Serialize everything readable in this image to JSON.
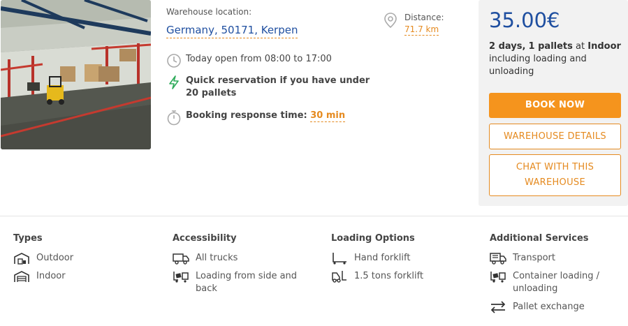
{
  "location": {
    "label": "Warehouse location:",
    "value": "Germany, 50171, Kerpen"
  },
  "distance": {
    "label": "Distance:",
    "value": "71.7 km"
  },
  "features": {
    "hours": "Today open from 08:00 to 17:00",
    "quick": "Quick reservation if you have under 20 pallets",
    "response_label": "Booking response time:",
    "response_value": "30 min"
  },
  "pricing": {
    "price": "35.00€",
    "days": "2 days,",
    "pallets": "1 pallets",
    "at": "at",
    "type": "Indoor",
    "rest": "including loading and unloading"
  },
  "buttons": {
    "book": "BOOK NOW",
    "details": "WAREHOUSE DETAILS",
    "chat": "CHAT WITH THIS WAREHOUSE"
  },
  "sections": {
    "types": {
      "title": "Types",
      "items": [
        "Outdoor",
        "Indoor"
      ]
    },
    "accessibility": {
      "title": "Accessibility",
      "items": [
        "All trucks",
        "Loading from side and back"
      ]
    },
    "loading": {
      "title": "Loading Options",
      "items": [
        "Hand forklift",
        "1.5 tons forklift"
      ]
    },
    "services": {
      "title": "Additional Services",
      "items": [
        "Transport",
        "Container loading / unloading",
        "Pallet exchange"
      ]
    }
  },
  "colors": {
    "accent": "#f5941d",
    "link": "#1f4fa0",
    "panel": "#f2f2f2"
  },
  "icons": [
    "location-pin-icon",
    "clock-icon",
    "lightning-icon",
    "stopwatch-icon",
    "warehouse-outdoor-icon",
    "warehouse-indoor-icon",
    "truck-icon",
    "side-loading-icon",
    "hand-forklift-icon",
    "forklift-icon",
    "transport-truck-icon",
    "container-loading-icon",
    "pallet-exchange-icon"
  ]
}
